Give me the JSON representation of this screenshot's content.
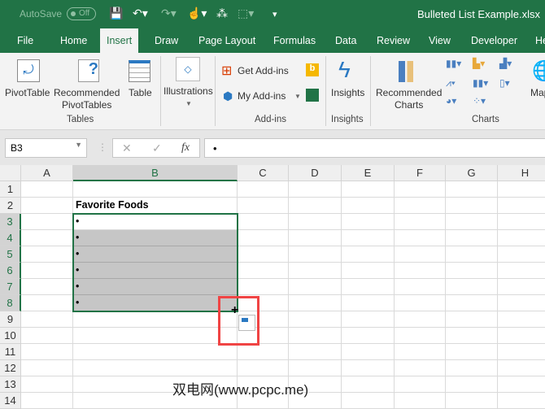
{
  "title": {
    "autosave": "AutoSave",
    "toggle": "Off",
    "document": "Bulleted List Example.xlsx"
  },
  "tabs": [
    "File",
    "Home",
    "Insert",
    "Draw",
    "Page Layout",
    "Formulas",
    "Data",
    "Review",
    "View",
    "Developer",
    "He"
  ],
  "active_tab": "Insert",
  "ribbon": {
    "pivot": "PivotTable",
    "recommended_pivot": [
      "Recommended",
      "PivotTables"
    ],
    "table": "Table",
    "tables_group": "Tables",
    "illustrations": "Illustrations",
    "get_addins": "Get Add-ins",
    "my_addins": "My Add-ins",
    "addins_group": "Add-ins",
    "insights": "Insights",
    "insights_group": "Insights",
    "recommended_charts": [
      "Recommended",
      "Charts"
    ],
    "charts_group": "Charts",
    "maps": "Map"
  },
  "formula_bar": {
    "name_box": "B3",
    "fx": "fx",
    "cancel": "✕",
    "enter": "✓",
    "value": "•"
  },
  "columns": [
    "A",
    "B",
    "C",
    "D",
    "E",
    "F",
    "G",
    "H"
  ],
  "rows": [
    "1",
    "2",
    "3",
    "4",
    "5",
    "6",
    "7",
    "8",
    "9",
    "10",
    "11",
    "12",
    "13",
    "14"
  ],
  "cells": {
    "B2": "Favorite Foods",
    "B3": "•",
    "B4": "•",
    "B5": "•",
    "B6": "•",
    "B7": "•",
    "B8": "•"
  },
  "watermark": "双电网(www.pcpc.me)",
  "colors": {
    "brand": "#217346",
    "highlight": "#c6c6c6",
    "callout": "#f04444"
  }
}
